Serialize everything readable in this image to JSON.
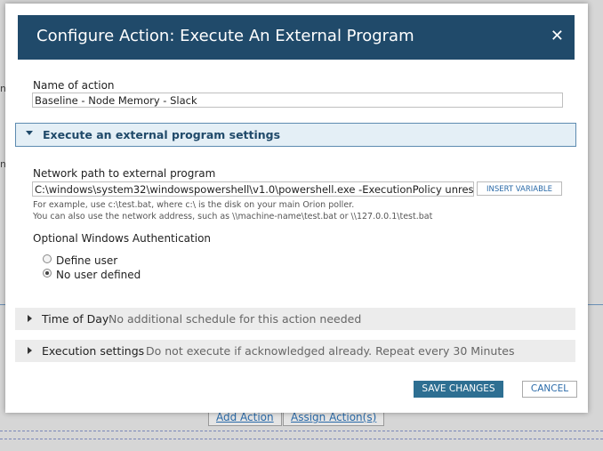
{
  "background": {
    "add_action": "Add Action",
    "assign_action": "Assign Action(s)",
    "edge_letter_1": "n",
    "edge_letter_2": "n"
  },
  "modal": {
    "title": "Configure Action: Execute An External Program",
    "close_icon": "close-icon"
  },
  "name_of_action": {
    "label": "Name of action",
    "value": "Baseline - Node Memory - Slack"
  },
  "external_program_section": {
    "title": "Execute an external program settings",
    "network_path_label": "Network path to external program",
    "network_path_value": "C:\\windows\\system32\\windowspowershell\\v1.0\\powershell.exe -ExecutionPolicy unrestric",
    "insert_variable": "INSERT VARIABLE",
    "hint_line_1": "For example, use c:\\test.bat, where c:\\ is the disk on your main Orion poller.",
    "hint_line_2": "You can also use the network address, such as \\\\machine-name\\test.bat or \\\\127.0.0.1\\test.bat",
    "auth_label": "Optional Windows Authentication",
    "options": [
      {
        "label": "Define user",
        "checked": false
      },
      {
        "label": "No user defined",
        "checked": true
      }
    ]
  },
  "time_of_day": {
    "title": "Time of Day",
    "summary": "No additional schedule for this action needed"
  },
  "execution_settings": {
    "title": "Execution settings",
    "summary": "Do not execute if acknowledged already. Repeat every 30 Minutes"
  },
  "footer": {
    "save": "SAVE CHANGES",
    "cancel": "CANCEL"
  },
  "colors": {
    "header_bg": "#204a6a",
    "save_bg": "#2e6f92",
    "link": "#2a6aa8"
  }
}
